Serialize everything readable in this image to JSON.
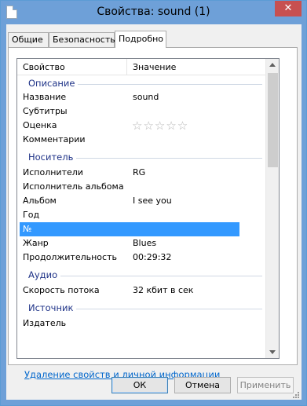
{
  "window": {
    "title": "Свойства: sound (1)",
    "close_glyph": "✕"
  },
  "tabs": [
    {
      "label": "Общие"
    },
    {
      "label": "Безопасность"
    },
    {
      "label": "Подробно"
    }
  ],
  "columns": {
    "property": "Свойство",
    "value": "Значение"
  },
  "groups": {
    "description": "Описание",
    "media": "Носитель",
    "audio": "Аудио",
    "source": "Источник"
  },
  "rows": {
    "name": {
      "k": "Название",
      "v": "sound"
    },
    "subtitle": {
      "k": "Субтитры",
      "v": ""
    },
    "rating": {
      "k": "Оценка",
      "stars": "☆☆☆☆☆",
      "value": 0,
      "max": 5
    },
    "comments": {
      "k": "Комментарии",
      "v": ""
    },
    "artists": {
      "k": "Исполнители",
      "v": "RG"
    },
    "album_artist": {
      "k": "Исполнитель альбома",
      "v": ""
    },
    "album": {
      "k": "Альбом",
      "v": "I see you"
    },
    "year": {
      "k": "Год",
      "v": ""
    },
    "number": {
      "k": "№",
      "v": ""
    },
    "genre": {
      "k": "Жанр",
      "v": "Blues"
    },
    "duration": {
      "k": "Продолжительность",
      "v": "00:29:32"
    },
    "bitrate": {
      "k": "Скорость потока",
      "v": "32 кбит в сек"
    },
    "publisher": {
      "k": "Издатель",
      "v": ""
    }
  },
  "link": "Удаление свойств и личной информации",
  "buttons": {
    "ok": "ОК",
    "cancel": "Отмена",
    "apply": "Применить"
  }
}
